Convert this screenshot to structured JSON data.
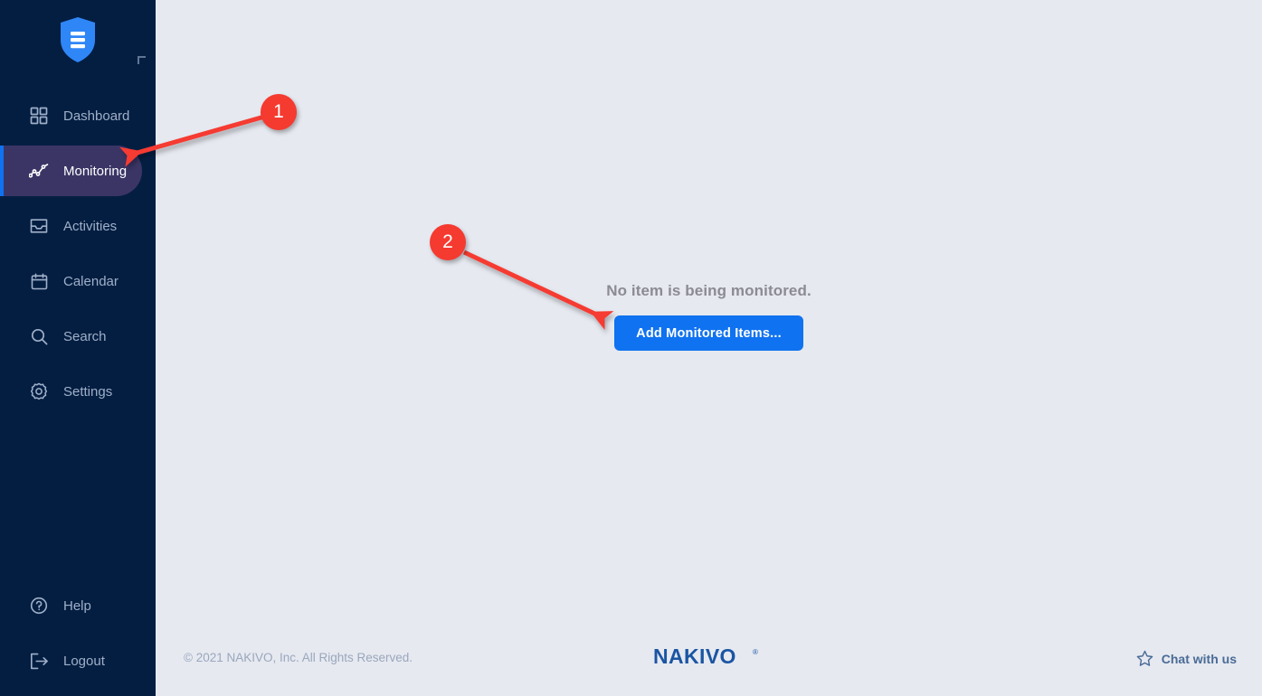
{
  "app": {
    "logo_icon": "shield-document-icon",
    "corner_marker": "corner-bracket-glyph"
  },
  "sidebar": {
    "items": [
      {
        "label": "Dashboard",
        "icon": "grid-icon",
        "active": false
      },
      {
        "label": "Monitoring",
        "icon": "line-chart-icon",
        "active": true
      },
      {
        "label": "Activities",
        "icon": "inbox-icon",
        "active": false
      },
      {
        "label": "Calendar",
        "icon": "calendar-icon",
        "active": false
      },
      {
        "label": "Search",
        "icon": "search-icon",
        "active": false
      },
      {
        "label": "Settings",
        "icon": "gear-icon",
        "active": false
      }
    ],
    "bottom_items": [
      {
        "label": "Help",
        "icon": "question-circle-icon"
      },
      {
        "label": "Logout",
        "icon": "logout-arrow-icon"
      }
    ],
    "colors": {
      "background": "#041e42",
      "active_background": "#3b3566",
      "active_accent": "#0f72f0",
      "label": "#9fb0c8",
      "active_label": "#ffffff"
    }
  },
  "main": {
    "empty_message": "No item is being monitored.",
    "add_button_label": "Add Monitored Items...",
    "background": "#e6e9f0",
    "button_color": "#0f72f0"
  },
  "footer": {
    "copyright": "© 2021 NAKIVO, Inc. All Rights Reserved.",
    "brand_name": "NAKIVO",
    "brand_trademark": "®",
    "brand_color": "#1a55a3",
    "chat_label": "Chat with us",
    "chat_icon": "star-outline-icon"
  },
  "annotations": {
    "color": "#f53a30",
    "markers": [
      {
        "number": "1",
        "target": "sidebar-item-monitoring"
      },
      {
        "number": "2",
        "target": "add-monitored-items-button"
      }
    ]
  }
}
